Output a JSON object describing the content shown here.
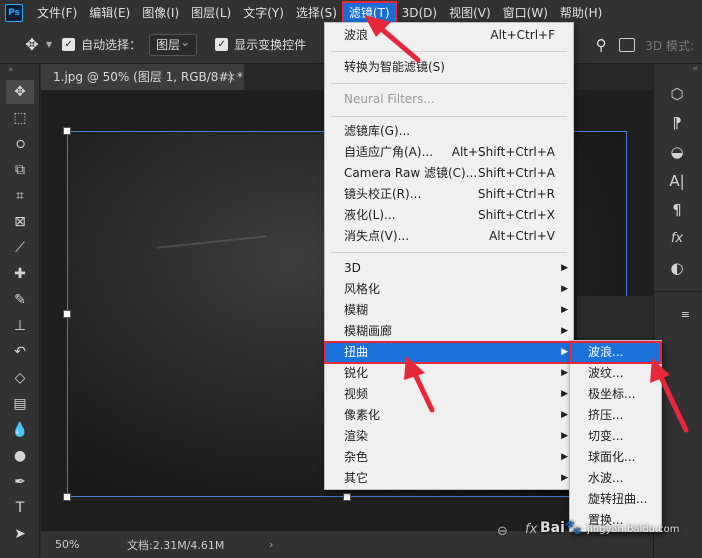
{
  "app": {
    "logo": "Ps"
  },
  "menubar": {
    "items": [
      "文件(F)",
      "编辑(E)",
      "图像(I)",
      "图层(L)",
      "文字(Y)",
      "选择(S)",
      "滤镜(T)",
      "3D(D)",
      "视图(V)",
      "窗口(W)",
      "帮助(H)"
    ],
    "active_index": 6
  },
  "options": {
    "auto_select_label": "自动选择：",
    "auto_select_checked": true,
    "layer_select_value": "图层",
    "show_transform_label": "显示变换控件",
    "show_transform_checked": true,
    "mode_3d_label": "3D 模式:"
  },
  "document": {
    "tab_title": "1.jpg @ 50% (图层 1, RGB/8#) *",
    "tab_close": "×"
  },
  "status": {
    "zoom": "50%",
    "doc_info": "文档:2.31M/4.61M"
  },
  "filter_menu": {
    "items": [
      {
        "label": "波浪",
        "shortcut": "Alt+Ctrl+F"
      },
      {
        "label": "转换为智能滤镜(S)"
      },
      {
        "label": "Neural Filters...",
        "disabled": true
      },
      {
        "label": "滤镜库(G)..."
      },
      {
        "label": "自适应广角(A)...",
        "shortcut": "Alt+Shift+Ctrl+A"
      },
      {
        "label": "Camera Raw 滤镜(C)...",
        "shortcut": "Shift+Ctrl+A"
      },
      {
        "label": "镜头校正(R)...",
        "shortcut": "Shift+Ctrl+R"
      },
      {
        "label": "液化(L)...",
        "shortcut": "Shift+Ctrl+X"
      },
      {
        "label": "消失点(V)...",
        "shortcut": "Alt+Ctrl+V"
      },
      {
        "label": "3D",
        "submenu": true
      },
      {
        "label": "风格化",
        "submenu": true
      },
      {
        "label": "模糊",
        "submenu": true
      },
      {
        "label": "模糊画廊",
        "submenu": true
      },
      {
        "label": "扭曲",
        "submenu": true,
        "highlighted": true
      },
      {
        "label": "锐化",
        "submenu": true
      },
      {
        "label": "视频",
        "submenu": true
      },
      {
        "label": "像素化",
        "submenu": true
      },
      {
        "label": "渲染",
        "submenu": true
      },
      {
        "label": "杂色",
        "submenu": true
      },
      {
        "label": "其它",
        "submenu": true
      }
    ]
  },
  "distort_submenu": {
    "items": [
      {
        "label": "波浪...",
        "highlighted": true
      },
      {
        "label": "波纹..."
      },
      {
        "label": "极坐标..."
      },
      {
        "label": "挤压..."
      },
      {
        "label": "切变..."
      },
      {
        "label": "球面化..."
      },
      {
        "label": "水波..."
      },
      {
        "label": "旋转扭曲..."
      },
      {
        "label": "置换..."
      }
    ]
  },
  "right_panel": {
    "icons": [
      "3d-cube-icon",
      "paragraph-style-icon",
      "swatch-icon",
      "character-icon",
      "paragraph-icon",
      "fx-icon",
      "adjust-icon"
    ],
    "values": [
      "%",
      "%"
    ],
    "footer_icons": [
      "link-icon",
      "fx-icon"
    ]
  },
  "watermark": {
    "main": "Bai",
    "paw": "🐾",
    "sub": "jingyan.baidu.com"
  },
  "colors": {
    "accent_menu": "#1a6dd6",
    "highlight": "#1c72db",
    "annotation": "#e8283a",
    "menu_bg": "#f0f0f0"
  }
}
